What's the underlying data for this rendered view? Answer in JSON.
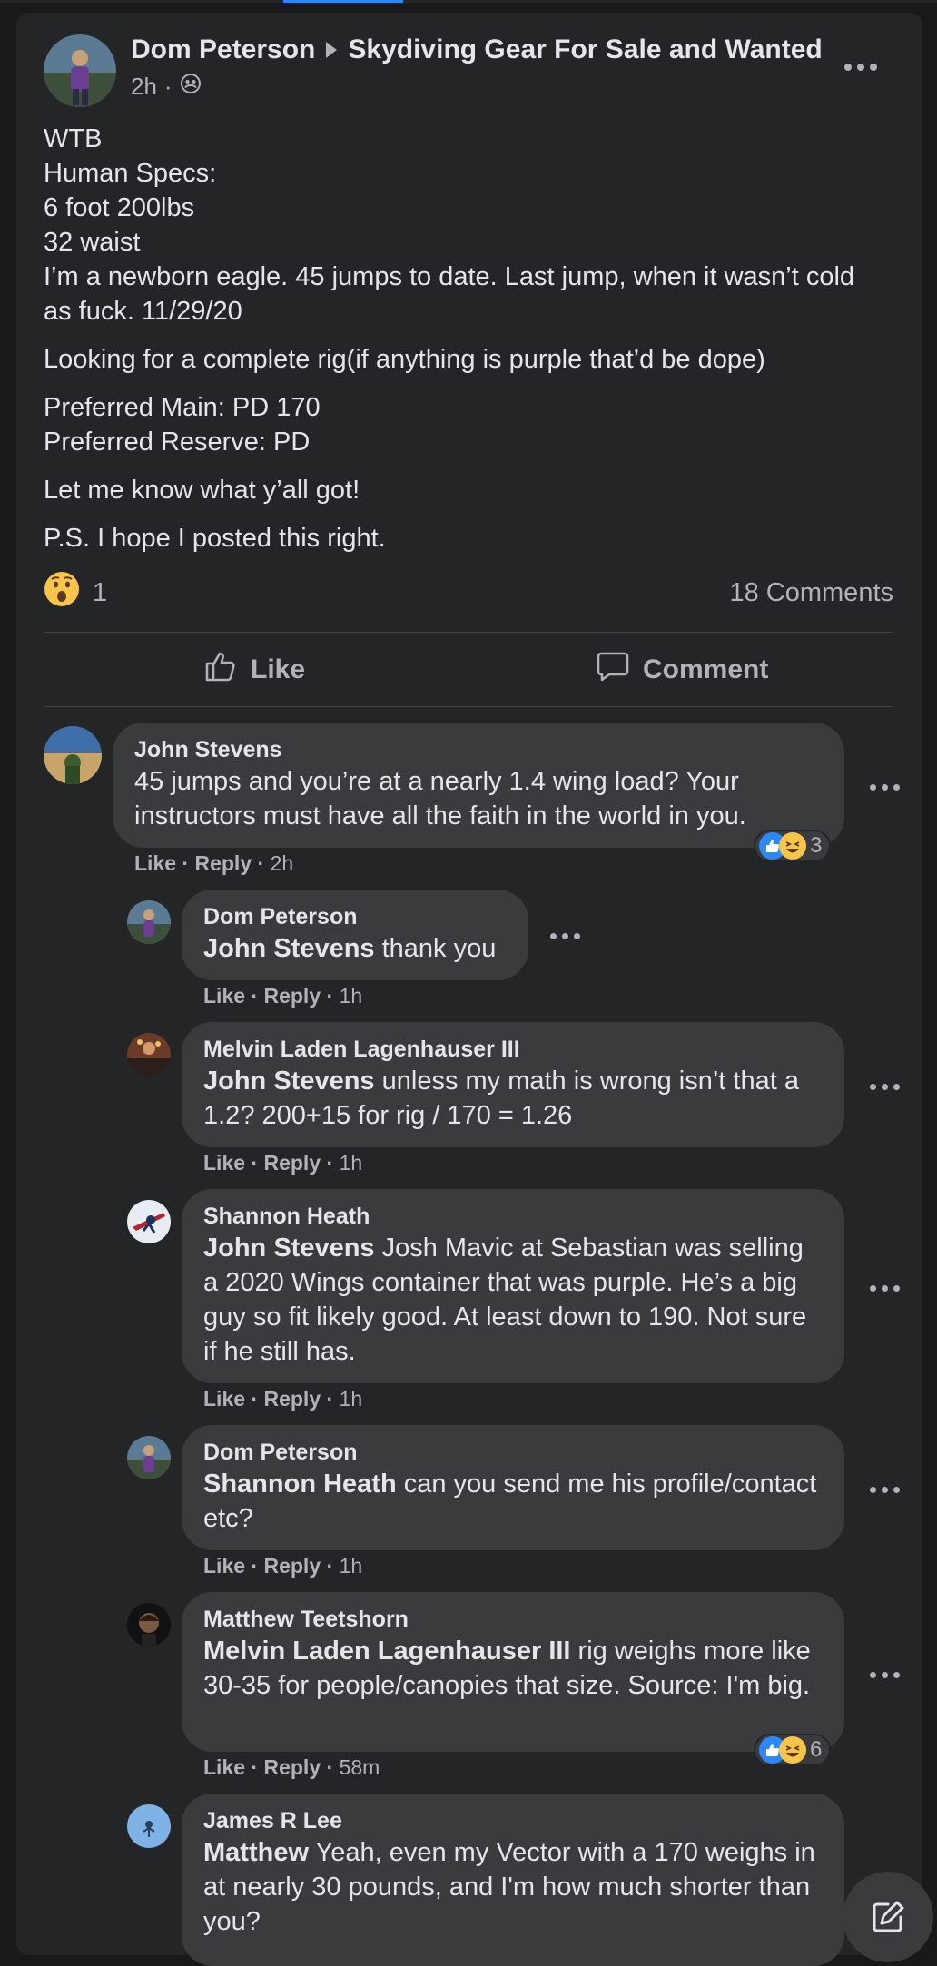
{
  "post": {
    "author": "Dom Peterson",
    "group": "Skydiving Gear For Sale and Wanted",
    "time": "2h",
    "privacy_icon": "group-icon",
    "body": [
      "WTB\nHuman Specs:\n6 foot 200lbs\n32 waist\nI’m a newborn eagle. 45 jumps to date. Last jump, when it wasn’t cold as fuck. 11/29/20",
      "Looking for a complete rig(if anything is purple that’d be dope)",
      "Preferred Main: PD 170\nPreferred Reserve: PD",
      "Let me know what y’all got!",
      "P.S. I hope I posted this right."
    ],
    "reaction_count": "1",
    "comments_count": "18 Comments",
    "like_label": "Like",
    "comment_label": "Comment"
  },
  "comments": [
    {
      "name": "John Stevens",
      "tag": "",
      "text": "45 jumps and you’re at a nearly 1.4 wing load? Your instructors must have all the faith in the world in you.",
      "like": "Like",
      "reply": "Reply",
      "time": "2h",
      "reactions": "3"
    },
    {
      "name": "Dom Peterson",
      "tag": "John Stevens",
      "text": " thank you",
      "like": "Like",
      "reply": "Reply",
      "time": "1h"
    },
    {
      "name": "Melvin Laden Lagenhauser III",
      "tag": "John Stevens",
      "text": " unless my math is wrong isn’t that a 1.2? 200+15 for rig / 170 = 1.26",
      "like": "Like",
      "reply": "Reply",
      "time": "1h"
    },
    {
      "name": "Shannon Heath",
      "tag": "John Stevens",
      "text": " Josh Mavic at Sebastian was selling a 2020 Wings container that was purple. He’s a big guy so fit likely good. At least down to 190. Not sure if he still has.",
      "like": "Like",
      "reply": "Reply",
      "time": "1h"
    },
    {
      "name": "Dom Peterson",
      "tag": "Shannon Heath",
      "text": " can you send me his profile/contact etc?",
      "like": "Like",
      "reply": "Reply",
      "time": "1h"
    },
    {
      "name": "Matthew Teetshorn",
      "tag": "Melvin Laden Lagenhauser III",
      "text": " rig weighs more like 30-35 for people/canopies that size. Source: I'm big.",
      "like": "Like",
      "reply": "Reply",
      "time": "58m",
      "reactions": "6"
    },
    {
      "name": "James R Lee",
      "tag": "Matthew",
      "text": " Yeah, even my Vector with a 170 weighs in at nearly 30 pounds, and I'm how much shorter than you?"
    }
  ],
  "colors": {
    "background": "#18191a",
    "card": "#242526",
    "bubble": "#3a3b3c",
    "text_primary": "#e4e6eb",
    "text_secondary": "#b0b3b8",
    "like_blue": "#2d88ff"
  }
}
